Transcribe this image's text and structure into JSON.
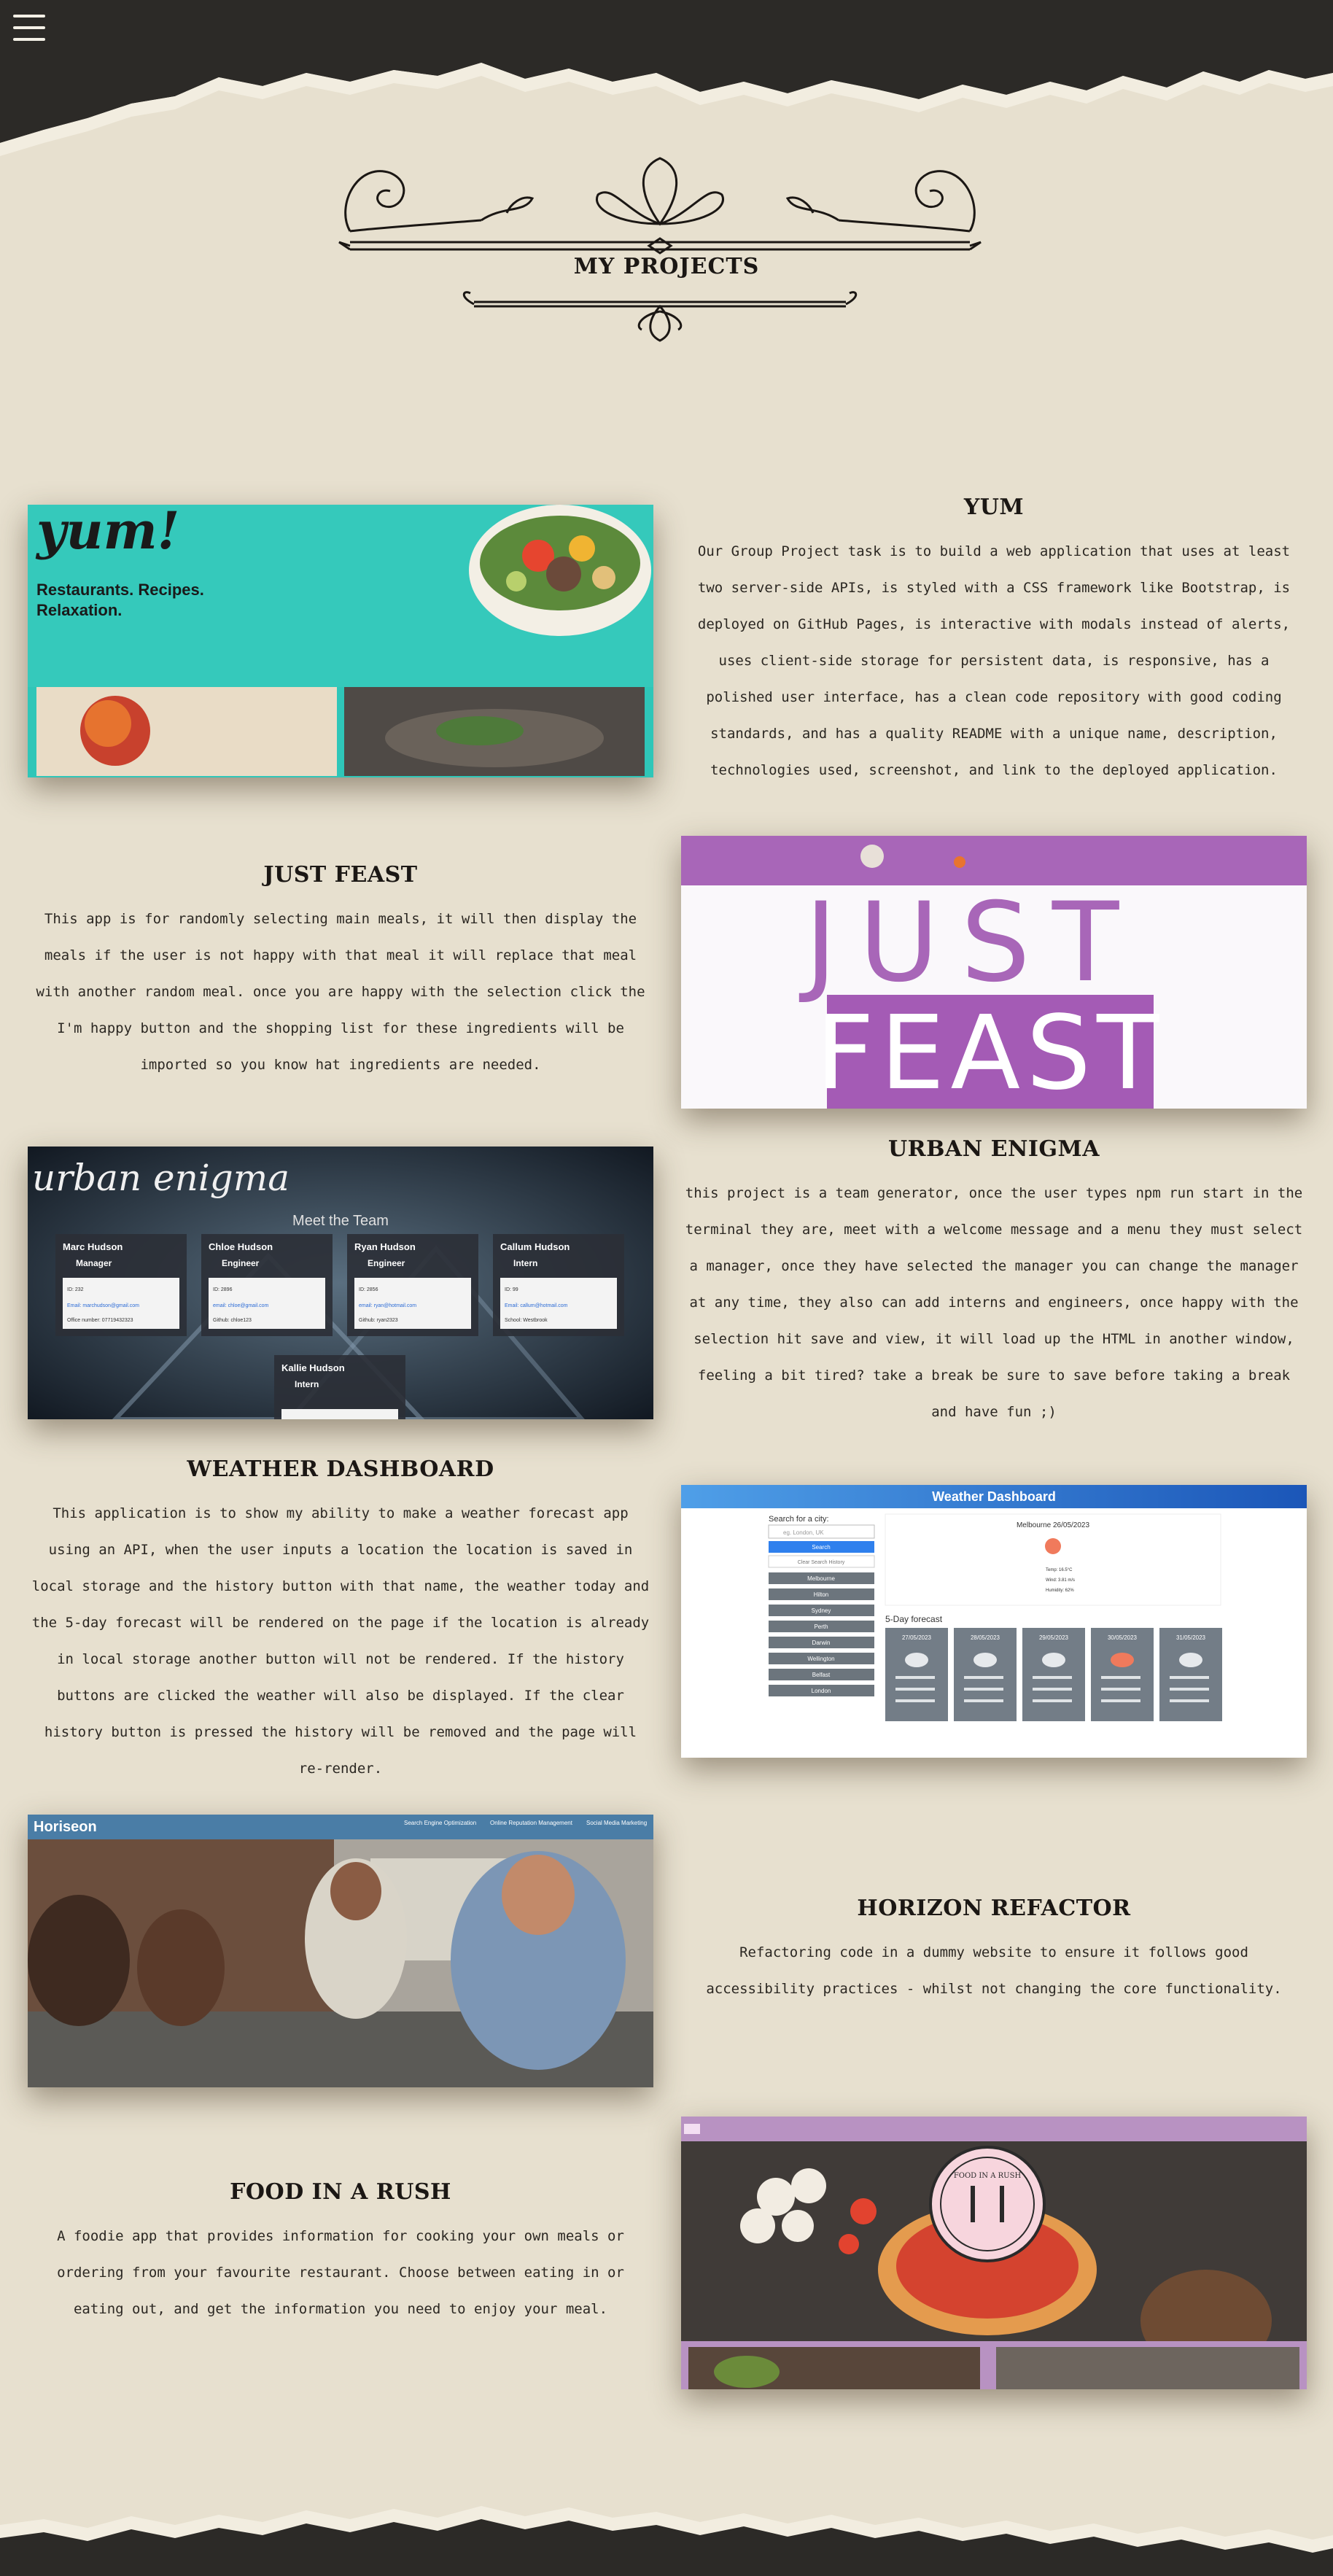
{
  "nav": {
    "menu_icon": "hamburger-menu-icon"
  },
  "page": {
    "title": "MY PROJECTS"
  },
  "projects": [
    {
      "title": "YUM",
      "description": "Our Group Project task is to build a web application that uses at least two server-side APIs, is styled with a CSS framework like Bootstrap, is deployed on GitHub Pages, is interactive with modals instead of alerts, uses client-side storage for persistent data, is responsive, has a polished user interface, has a clean code repository with good coding standards, and has a quality README with a unique name, description, technologies used, screenshot, and link to the deployed application.",
      "shot": {
        "logo": "yum!",
        "tagline_1": "Restaurants. Recipes.",
        "tagline_2": "Relaxation."
      }
    },
    {
      "title": "JUST FEAST",
      "description": "This app is for randomly selecting main meals, it will then display the meals if the user is not happy with that meal it will replace that meal with another random meal. once you are happy with the selection click the I'm happy button and the shopping list for these ingredients will be imported so you know hat ingredients are needed.",
      "shot": {
        "word_1": "JUST",
        "word_2": "FEAST"
      }
    },
    {
      "title": "URBAN ENIGMA",
      "description": "this project is a team generator, once the user types npm run start in the terminal they are, meet with a welcome message and a menu they must select a manager, once they have selected the manager you can change the manager at any time, they also can add interns and engineers, once happy with the selection hit save and view, it will load up the HTML in another window, feeling a bit tired? take a break be sure to save before taking a break and have fun ;)",
      "shot": {
        "logo": "urban enigma",
        "heading": "Meet the Team",
        "cards": [
          {
            "name": "Marc Hudson",
            "role": "Manager",
            "id": "ID: 232",
            "email": "Email: marchudson@gmail.com",
            "extra": "Office number: 07719432323"
          },
          {
            "name": "Chloe Hudson",
            "role": "Engineer",
            "id": "ID: 2896",
            "email": "email: chloe@gmail.com",
            "extra": "Github: chloe123"
          },
          {
            "name": "Ryan Hudson",
            "role": "Engineer",
            "id": "ID: 2856",
            "email": "email: ryan@hotmail.com",
            "extra": "Github: ryan2323"
          },
          {
            "name": "Callum Hudson",
            "role": "Intern",
            "id": "ID: 99",
            "email": "Email: callum@hotmail.com",
            "extra": "School: Westbrook"
          },
          {
            "name": "Kallie Hudson",
            "role": "Intern",
            "id": "",
            "email": "",
            "extra": ""
          }
        ]
      }
    },
    {
      "title": "WEATHER DASHBOARD",
      "description": "This application is to show my ability to make a weather forecast app using an API, when the user inputs a location the location is saved in local storage and the history button with that name, the weather today and the 5-day forecast will be rendered on the page if the location is already in local storage another button will not be rendered. If the history buttons are clicked the weather will also be displayed. If the clear history button is pressed the history will be removed and the page will re-render.",
      "shot": {
        "header": "Weather Dashboard",
        "search_label": "Search for a city:",
        "search_placeholder": "eg. London, UK",
        "search_button": "Search",
        "clear_button": "Clear Search History",
        "history": [
          "Melbourne",
          "Hilton",
          "Sydney",
          "Perth",
          "Darwin",
          "Wellington",
          "Belfast",
          "London"
        ],
        "today_title": "Melbourne 26/05/2023",
        "today_temp": "Temp: 16.5°C",
        "today_wind": "Wind: 3.81 m/s",
        "today_humidity": "Humidity: 62%",
        "forecast_title": "5-Day forecast",
        "forecast_days": [
          "27/05/2023",
          "28/05/2023",
          "29/05/2023",
          "30/05/2023",
          "31/05/2023"
        ]
      }
    },
    {
      "title": "HORIZON REFACTOR",
      "description": "Refactoring code in a dummy website to ensure it follows good accessibility practices - whilst not changing the core functionality.",
      "shot": {
        "logo": "Horiseon",
        "nav": [
          "Search Engine Optimization",
          "Online Reputation Management",
          "Social Media Marketing"
        ]
      }
    },
    {
      "title": "FOOD IN A RUSH",
      "description": "A foodie app that provides information for cooking your own meals or ordering from your favourite restaurant. Choose between eating in or eating out, and get the information you need to enjoy your meal.",
      "shot": {
        "badge_text": "FOOD IN A RUSH"
      }
    }
  ],
  "colors": {
    "background": "#e7e0cf",
    "torn_paper_dark": "#2c2a27",
    "yum_teal": "#2fc6b8",
    "feast_purple": "#a866b8",
    "weather_blue": "#1f72d4",
    "horiseon_blue": "#4a7da6"
  }
}
